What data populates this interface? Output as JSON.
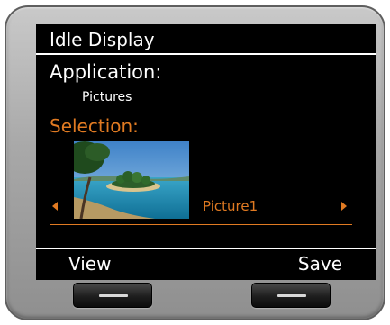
{
  "screen": {
    "title": "Idle Display",
    "application_label": "Application:",
    "application_value": "Pictures",
    "selection_label": "Selection:",
    "picture_name": "Picture1",
    "softkeys": {
      "left": "View",
      "right": "Save"
    }
  },
  "icons": {
    "prev": "arrow-left-icon",
    "next": "arrow-right-icon"
  },
  "colors": {
    "screen_bg": "#000000",
    "text": "#ffffff",
    "accent": "#e07a22",
    "bezel": "#b0b0b0"
  }
}
